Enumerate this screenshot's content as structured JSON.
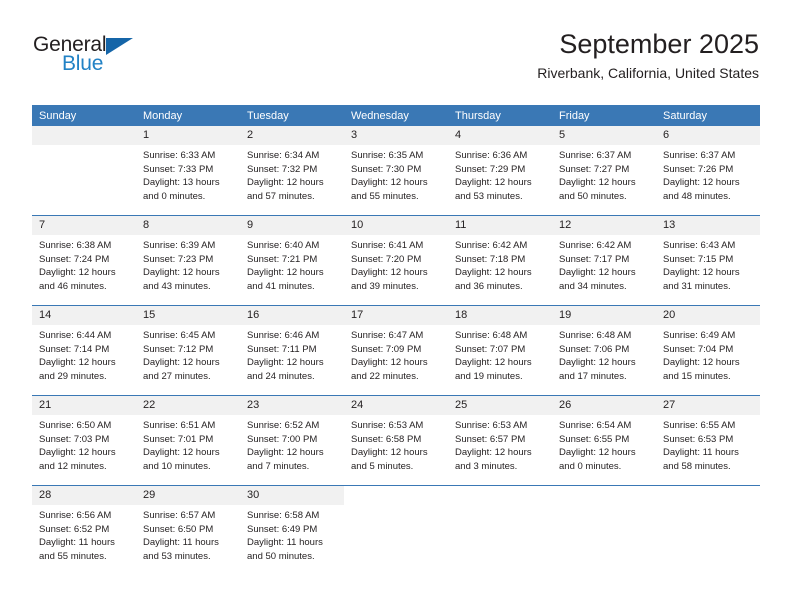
{
  "brand": {
    "name_top": "General",
    "name_bottom": "Blue",
    "accent_color": "#2282c5",
    "triangle_color": "#1565a8"
  },
  "header": {
    "month_title": "September 2025",
    "location": "Riverbank, California, United States"
  },
  "calendar": {
    "header_bg": "#3a78b5",
    "daynum_bg": "#f1f1f1",
    "weekdays": [
      "Sunday",
      "Monday",
      "Tuesday",
      "Wednesday",
      "Thursday",
      "Friday",
      "Saturday"
    ],
    "weeks": [
      [
        {
          "day": "",
          "sunrise": "",
          "sunset": "",
          "daylight_1": "",
          "daylight_2": "",
          "empty": true
        },
        {
          "day": "1",
          "sunrise": "Sunrise: 6:33 AM",
          "sunset": "Sunset: 7:33 PM",
          "daylight_1": "Daylight: 13 hours",
          "daylight_2": "and 0 minutes."
        },
        {
          "day": "2",
          "sunrise": "Sunrise: 6:34 AM",
          "sunset": "Sunset: 7:32 PM",
          "daylight_1": "Daylight: 12 hours",
          "daylight_2": "and 57 minutes."
        },
        {
          "day": "3",
          "sunrise": "Sunrise: 6:35 AM",
          "sunset": "Sunset: 7:30 PM",
          "daylight_1": "Daylight: 12 hours",
          "daylight_2": "and 55 minutes."
        },
        {
          "day": "4",
          "sunrise": "Sunrise: 6:36 AM",
          "sunset": "Sunset: 7:29 PM",
          "daylight_1": "Daylight: 12 hours",
          "daylight_2": "and 53 minutes."
        },
        {
          "day": "5",
          "sunrise": "Sunrise: 6:37 AM",
          "sunset": "Sunset: 7:27 PM",
          "daylight_1": "Daylight: 12 hours",
          "daylight_2": "and 50 minutes."
        },
        {
          "day": "6",
          "sunrise": "Sunrise: 6:37 AM",
          "sunset": "Sunset: 7:26 PM",
          "daylight_1": "Daylight: 12 hours",
          "daylight_2": "and 48 minutes."
        }
      ],
      [
        {
          "day": "7",
          "sunrise": "Sunrise: 6:38 AM",
          "sunset": "Sunset: 7:24 PM",
          "daylight_1": "Daylight: 12 hours",
          "daylight_2": "and 46 minutes."
        },
        {
          "day": "8",
          "sunrise": "Sunrise: 6:39 AM",
          "sunset": "Sunset: 7:23 PM",
          "daylight_1": "Daylight: 12 hours",
          "daylight_2": "and 43 minutes."
        },
        {
          "day": "9",
          "sunrise": "Sunrise: 6:40 AM",
          "sunset": "Sunset: 7:21 PM",
          "daylight_1": "Daylight: 12 hours",
          "daylight_2": "and 41 minutes."
        },
        {
          "day": "10",
          "sunrise": "Sunrise: 6:41 AM",
          "sunset": "Sunset: 7:20 PM",
          "daylight_1": "Daylight: 12 hours",
          "daylight_2": "and 39 minutes."
        },
        {
          "day": "11",
          "sunrise": "Sunrise: 6:42 AM",
          "sunset": "Sunset: 7:18 PM",
          "daylight_1": "Daylight: 12 hours",
          "daylight_2": "and 36 minutes."
        },
        {
          "day": "12",
          "sunrise": "Sunrise: 6:42 AM",
          "sunset": "Sunset: 7:17 PM",
          "daylight_1": "Daylight: 12 hours",
          "daylight_2": "and 34 minutes."
        },
        {
          "day": "13",
          "sunrise": "Sunrise: 6:43 AM",
          "sunset": "Sunset: 7:15 PM",
          "daylight_1": "Daylight: 12 hours",
          "daylight_2": "and 31 minutes."
        }
      ],
      [
        {
          "day": "14",
          "sunrise": "Sunrise: 6:44 AM",
          "sunset": "Sunset: 7:14 PM",
          "daylight_1": "Daylight: 12 hours",
          "daylight_2": "and 29 minutes."
        },
        {
          "day": "15",
          "sunrise": "Sunrise: 6:45 AM",
          "sunset": "Sunset: 7:12 PM",
          "daylight_1": "Daylight: 12 hours",
          "daylight_2": "and 27 minutes."
        },
        {
          "day": "16",
          "sunrise": "Sunrise: 6:46 AM",
          "sunset": "Sunset: 7:11 PM",
          "daylight_1": "Daylight: 12 hours",
          "daylight_2": "and 24 minutes."
        },
        {
          "day": "17",
          "sunrise": "Sunrise: 6:47 AM",
          "sunset": "Sunset: 7:09 PM",
          "daylight_1": "Daylight: 12 hours",
          "daylight_2": "and 22 minutes."
        },
        {
          "day": "18",
          "sunrise": "Sunrise: 6:48 AM",
          "sunset": "Sunset: 7:07 PM",
          "daylight_1": "Daylight: 12 hours",
          "daylight_2": "and 19 minutes."
        },
        {
          "day": "19",
          "sunrise": "Sunrise: 6:48 AM",
          "sunset": "Sunset: 7:06 PM",
          "daylight_1": "Daylight: 12 hours",
          "daylight_2": "and 17 minutes."
        },
        {
          "day": "20",
          "sunrise": "Sunrise: 6:49 AM",
          "sunset": "Sunset: 7:04 PM",
          "daylight_1": "Daylight: 12 hours",
          "daylight_2": "and 15 minutes."
        }
      ],
      [
        {
          "day": "21",
          "sunrise": "Sunrise: 6:50 AM",
          "sunset": "Sunset: 7:03 PM",
          "daylight_1": "Daylight: 12 hours",
          "daylight_2": "and 12 minutes."
        },
        {
          "day": "22",
          "sunrise": "Sunrise: 6:51 AM",
          "sunset": "Sunset: 7:01 PM",
          "daylight_1": "Daylight: 12 hours",
          "daylight_2": "and 10 minutes."
        },
        {
          "day": "23",
          "sunrise": "Sunrise: 6:52 AM",
          "sunset": "Sunset: 7:00 PM",
          "daylight_1": "Daylight: 12 hours",
          "daylight_2": "and 7 minutes."
        },
        {
          "day": "24",
          "sunrise": "Sunrise: 6:53 AM",
          "sunset": "Sunset: 6:58 PM",
          "daylight_1": "Daylight: 12 hours",
          "daylight_2": "and 5 minutes."
        },
        {
          "day": "25",
          "sunrise": "Sunrise: 6:53 AM",
          "sunset": "Sunset: 6:57 PM",
          "daylight_1": "Daylight: 12 hours",
          "daylight_2": "and 3 minutes."
        },
        {
          "day": "26",
          "sunrise": "Sunrise: 6:54 AM",
          "sunset": "Sunset: 6:55 PM",
          "daylight_1": "Daylight: 12 hours",
          "daylight_2": "and 0 minutes."
        },
        {
          "day": "27",
          "sunrise": "Sunrise: 6:55 AM",
          "sunset": "Sunset: 6:53 PM",
          "daylight_1": "Daylight: 11 hours",
          "daylight_2": "and 58 minutes."
        }
      ],
      [
        {
          "day": "28",
          "sunrise": "Sunrise: 6:56 AM",
          "sunset": "Sunset: 6:52 PM",
          "daylight_1": "Daylight: 11 hours",
          "daylight_2": "and 55 minutes."
        },
        {
          "day": "29",
          "sunrise": "Sunrise: 6:57 AM",
          "sunset": "Sunset: 6:50 PM",
          "daylight_1": "Daylight: 11 hours",
          "daylight_2": "and 53 minutes."
        },
        {
          "day": "30",
          "sunrise": "Sunrise: 6:58 AM",
          "sunset": "Sunset: 6:49 PM",
          "daylight_1": "Daylight: 11 hours",
          "daylight_2": "and 50 minutes."
        },
        {
          "day": "",
          "sunrise": "",
          "sunset": "",
          "daylight_1": "",
          "daylight_2": "",
          "empty": true,
          "blank": true
        },
        {
          "day": "",
          "sunrise": "",
          "sunset": "",
          "daylight_1": "",
          "daylight_2": "",
          "empty": true,
          "blank": true
        },
        {
          "day": "",
          "sunrise": "",
          "sunset": "",
          "daylight_1": "",
          "daylight_2": "",
          "empty": true,
          "blank": true
        },
        {
          "day": "",
          "sunrise": "",
          "sunset": "",
          "daylight_1": "",
          "daylight_2": "",
          "empty": true,
          "blank": true
        }
      ]
    ]
  }
}
